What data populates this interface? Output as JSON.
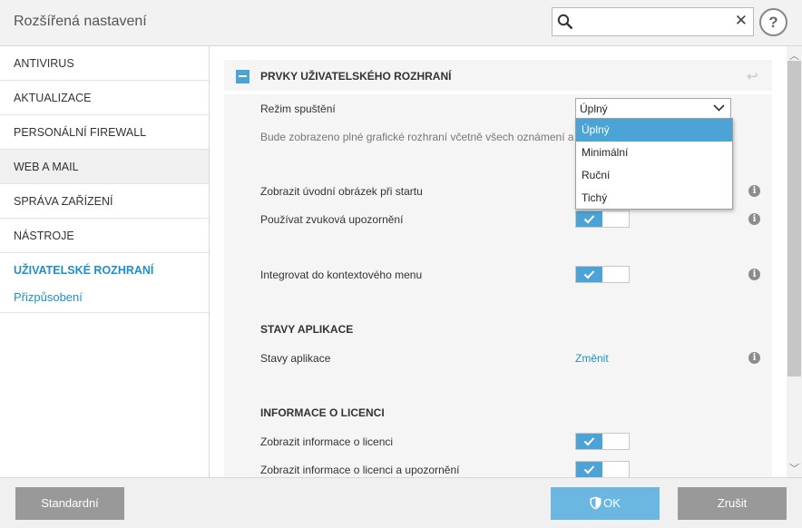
{
  "window": {
    "title": "Rozšířená nastavení"
  },
  "search": {
    "placeholder": "",
    "value": ""
  },
  "sidebar": {
    "items": [
      {
        "label": "ANTIVIRUS"
      },
      {
        "label": "AKTUALIZACE"
      },
      {
        "label": "PERSONÁLNÍ FIREWALL"
      },
      {
        "label": "WEB A MAIL"
      },
      {
        "label": "SPRÁVA ZAŘÍZENÍ"
      },
      {
        "label": "NÁSTROJE"
      },
      {
        "label": "UŽIVATELSKÉ ROZHRANÍ"
      }
    ],
    "sub_item": "Přizpůsobení"
  },
  "content": {
    "section_header": "PRVKY UŽIVATELSKÉHO ROZHRANÍ",
    "start_mode": {
      "label": "Režim spuštění",
      "selected": "Úplný",
      "description": "Bude zobrazeno plné grafické rozhraní včetně všech oznámení a u",
      "options": [
        "Úplný",
        "Minimální",
        "Ruční",
        "Tichý"
      ]
    },
    "splash_label": "Zobrazit úvodní obrázek při startu",
    "sound_label": "Používat zvuková upozornění",
    "context_menu_label": "Integrovat do kontextového menu",
    "app_states": {
      "title": "STAVY APLIKACE",
      "label": "Stavy aplikace",
      "link": "Změnit"
    },
    "license": {
      "title": "INFORMACE O LICENCI",
      "show_info_label": "Zobrazit informace o licenci",
      "show_info_warn_label": "Zobrazit informace o licenci a upozornění"
    },
    "toggles": {
      "sound": true,
      "context_menu": true,
      "license_info": true,
      "license_warn": true
    }
  },
  "footer": {
    "standard": "Standardní",
    "ok": "OK",
    "cancel": "Zrušit"
  },
  "colors": {
    "accent": "#4ba3d6",
    "link": "#1f8fcb",
    "button_gray": "#999999",
    "ok_button": "#6ab8e2"
  }
}
